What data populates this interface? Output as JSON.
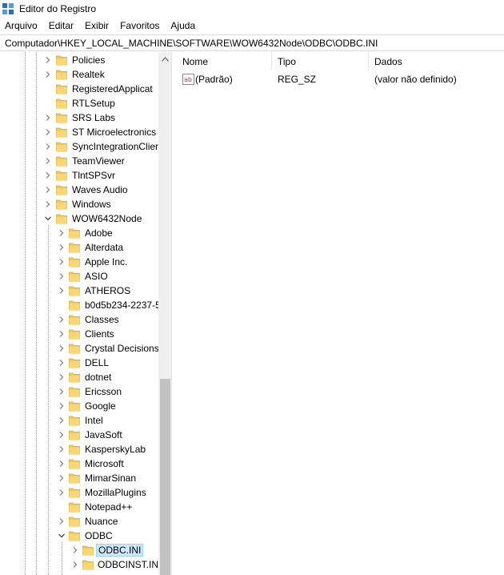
{
  "window": {
    "title": "Editor do Registro"
  },
  "menu": [
    "Arquivo",
    "Editar",
    "Exibir",
    "Favoritos",
    "Ajuda"
  ],
  "address": "Computador\\HKEY_LOCAL_MACHINE\\SOFTWARE\\WOW6432Node\\ODBC\\ODBC.INI",
  "tree": [
    {
      "label": "Policies",
      "level": 0,
      "state": "collapsed"
    },
    {
      "label": "Realtek",
      "level": 0,
      "state": "collapsed"
    },
    {
      "label": "RegisteredApplicat",
      "level": 0,
      "state": "leaf"
    },
    {
      "label": "RTLSetup",
      "level": 0,
      "state": "leaf"
    },
    {
      "label": "SRS Labs",
      "level": 0,
      "state": "collapsed"
    },
    {
      "label": "ST Microelectronics",
      "level": 0,
      "state": "collapsed"
    },
    {
      "label": "SyncIntegrationClier",
      "level": 0,
      "state": "collapsed"
    },
    {
      "label": "TeamViewer",
      "level": 0,
      "state": "collapsed"
    },
    {
      "label": "TlntSPSvr",
      "level": 0,
      "state": "collapsed"
    },
    {
      "label": "Waves Audio",
      "level": 0,
      "state": "collapsed"
    },
    {
      "label": "Windows",
      "level": 0,
      "state": "collapsed"
    },
    {
      "label": "WOW6432Node",
      "level": 0,
      "state": "expanded"
    },
    {
      "label": "Adobe",
      "level": 1,
      "state": "collapsed"
    },
    {
      "label": "Alterdata",
      "level": 1,
      "state": "collapsed"
    },
    {
      "label": "Apple Inc.",
      "level": 1,
      "state": "collapsed"
    },
    {
      "label": "ASIO",
      "level": 1,
      "state": "collapsed"
    },
    {
      "label": "ATHEROS",
      "level": 1,
      "state": "collapsed"
    },
    {
      "label": "b0d5b234-2237-5",
      "level": 1,
      "state": "leaf"
    },
    {
      "label": "Classes",
      "level": 1,
      "state": "collapsed"
    },
    {
      "label": "Clients",
      "level": 1,
      "state": "collapsed"
    },
    {
      "label": "Crystal Decisions",
      "level": 1,
      "state": "collapsed"
    },
    {
      "label": "DELL",
      "level": 1,
      "state": "collapsed"
    },
    {
      "label": "dotnet",
      "level": 1,
      "state": "collapsed"
    },
    {
      "label": "Ericsson",
      "level": 1,
      "state": "collapsed"
    },
    {
      "label": "Google",
      "level": 1,
      "state": "collapsed"
    },
    {
      "label": "Intel",
      "level": 1,
      "state": "collapsed"
    },
    {
      "label": "JavaSoft",
      "level": 1,
      "state": "collapsed"
    },
    {
      "label": "KasperskyLab",
      "level": 1,
      "state": "collapsed"
    },
    {
      "label": "Microsoft",
      "level": 1,
      "state": "collapsed"
    },
    {
      "label": "MimarSinan",
      "level": 1,
      "state": "collapsed"
    },
    {
      "label": "MozillaPlugins",
      "level": 1,
      "state": "collapsed"
    },
    {
      "label": "Notepad++",
      "level": 1,
      "state": "leaf"
    },
    {
      "label": "Nuance",
      "level": 1,
      "state": "collapsed"
    },
    {
      "label": "ODBC",
      "level": 1,
      "state": "expanded"
    },
    {
      "label": "ODBC.INI",
      "level": 2,
      "state": "collapsed",
      "selected": true
    },
    {
      "label": "ODBCINST.INI",
      "level": 2,
      "state": "collapsed"
    }
  ],
  "list": {
    "columns": [
      "Nome",
      "Tipo",
      "Dados"
    ],
    "rows": [
      {
        "name": "(Padrão)",
        "type": "REG_SZ",
        "data": "(valor não definido)",
        "icon": "string-value-icon"
      }
    ]
  },
  "colors": {
    "selection": "#cce8ff",
    "folder": "#f3c959",
    "scrollbar_thumb": "#c1c1c1"
  }
}
